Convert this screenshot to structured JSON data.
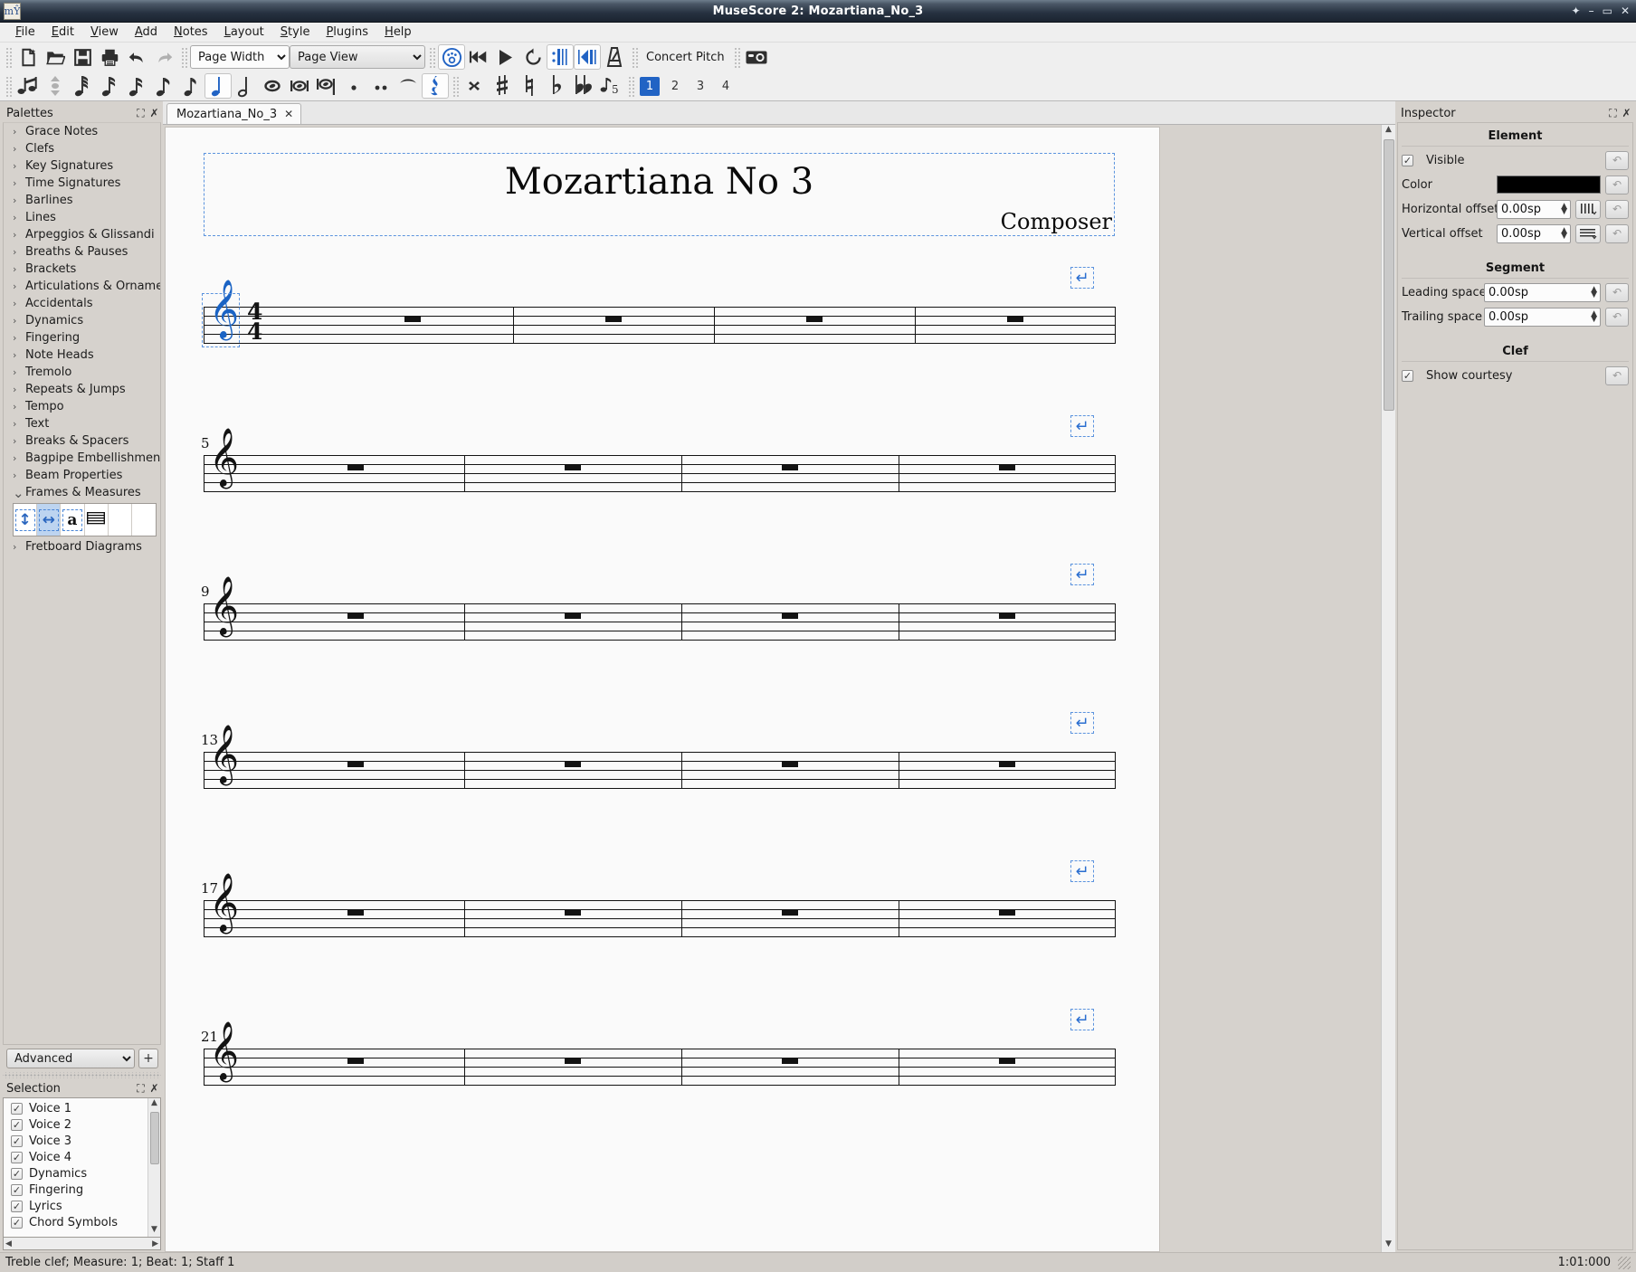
{
  "window": {
    "title": "MuseScore 2: Mozartiana_No_3",
    "app_icon": "musescore-logo-icon",
    "minimize": "–",
    "maximize": "▭",
    "close": "✕",
    "pin": "✦"
  },
  "menubar": [
    {
      "label": "File"
    },
    {
      "label": "Edit"
    },
    {
      "label": "View"
    },
    {
      "label": "Add"
    },
    {
      "label": "Notes"
    },
    {
      "label": "Layout"
    },
    {
      "label": "Style"
    },
    {
      "label": "Plugins"
    },
    {
      "label": "Help"
    }
  ],
  "toolbar": {
    "zoom_value": "Page Width",
    "view_value": "Page View",
    "concert_pitch_label": "Concert Pitch",
    "file_buttons": [
      "new-score-icon",
      "open-score-icon",
      "save-score-icon",
      "print-icon",
      "undo-icon",
      "redo-icon"
    ],
    "playback_buttons": [
      "midi-input-icon",
      "rewind-icon",
      "play-icon",
      "loop-icon",
      "play-repeats-icon",
      "play-next-icon",
      "metronome-icon"
    ],
    "camera_label": "image-capture-icon",
    "note_durations": [
      "64th-note",
      "32nd-note",
      "16th-note",
      "eighth-note",
      "quarter-note-selected",
      "half-note",
      "whole-note",
      "breve",
      "longa"
    ],
    "dot_buttons": [
      "augmentation-dot",
      "double-augmentation-dot"
    ],
    "tie_button": "tie-icon",
    "rest_button": "rest-icon",
    "accidentals": [
      "double-sharp",
      "sharp",
      "natural",
      "flat",
      "double-flat",
      "flip-direction"
    ],
    "voices": [
      "1",
      "2",
      "3",
      "4"
    ],
    "voice_selected": "1"
  },
  "palettes": {
    "title": "Palettes",
    "undock_icon": "undock-icon",
    "close_icon": "close-icon",
    "items": [
      {
        "label": "Grace Notes",
        "expanded": false
      },
      {
        "label": "Clefs",
        "expanded": false
      },
      {
        "label": "Key Signatures",
        "expanded": false
      },
      {
        "label": "Time Signatures",
        "expanded": false
      },
      {
        "label": "Barlines",
        "expanded": false
      },
      {
        "label": "Lines",
        "expanded": false
      },
      {
        "label": "Arpeggios & Glissandi",
        "expanded": false
      },
      {
        "label": "Breaths & Pauses",
        "expanded": false
      },
      {
        "label": "Brackets",
        "expanded": false
      },
      {
        "label": "Articulations & Ornaments",
        "expanded": false
      },
      {
        "label": "Accidentals",
        "expanded": false
      },
      {
        "label": "Dynamics",
        "expanded": false
      },
      {
        "label": "Fingering",
        "expanded": false
      },
      {
        "label": "Note Heads",
        "expanded": false
      },
      {
        "label": "Tremolo",
        "expanded": false
      },
      {
        "label": "Repeats & Jumps",
        "expanded": false
      },
      {
        "label": "Tempo",
        "expanded": false
      },
      {
        "label": "Text",
        "expanded": false
      },
      {
        "label": "Breaks & Spacers",
        "expanded": false
      },
      {
        "label": "Bagpipe Embellishments",
        "expanded": false
      },
      {
        "label": "Beam Properties",
        "expanded": false
      },
      {
        "label": "Frames & Measures",
        "expanded": true
      },
      {
        "label": "Fretboard Diagrams",
        "expanded": false
      }
    ],
    "frames_cells": [
      {
        "name": "vertical-frame",
        "glyph": "↕",
        "selected": false
      },
      {
        "name": "horizontal-frame",
        "glyph": "↔",
        "selected": true
      },
      {
        "name": "text-frame",
        "glyph": "a",
        "selected": false
      },
      {
        "name": "staff-measure",
        "glyph": "≡",
        "selected": false
      },
      {
        "name": "empty-cell-1",
        "glyph": "",
        "selected": false
      },
      {
        "name": "empty-cell-2",
        "glyph": "",
        "selected": false
      }
    ],
    "mode_value": "Advanced",
    "add_button": "+"
  },
  "selection": {
    "title": "Selection",
    "undock_icon": "undock-icon",
    "close_icon": "close-icon",
    "items": [
      {
        "label": "Voice 1",
        "checked": true
      },
      {
        "label": "Voice 2",
        "checked": true
      },
      {
        "label": "Voice 3",
        "checked": true
      },
      {
        "label": "Voice 4",
        "checked": true
      },
      {
        "label": "Dynamics",
        "checked": true
      },
      {
        "label": "Fingering",
        "checked": true
      },
      {
        "label": "Lyrics",
        "checked": true
      },
      {
        "label": "Chord Symbols",
        "checked": true
      }
    ]
  },
  "document_tab": {
    "label": "Mozartiana_No_3",
    "close_icon": "close-icon"
  },
  "score": {
    "title": "Mozartiana No 3",
    "composer": "Composer",
    "clef": "treble-clef",
    "clef_glyph": "𝄞",
    "time_signature": {
      "numerator": "4",
      "denominator": "4"
    },
    "systems": [
      {
        "measure_number": "",
        "first": true,
        "measures": 4
      },
      {
        "measure_number": "5",
        "first": false,
        "measures": 4
      },
      {
        "measure_number": "9",
        "first": false,
        "measures": 4
      },
      {
        "measure_number": "13",
        "first": false,
        "measures": 4
      },
      {
        "measure_number": "17",
        "first": false,
        "measures": 4
      },
      {
        "measure_number": "21",
        "first": false,
        "measures": 4
      }
    ],
    "break_marker_glyph": "↵"
  },
  "inspector": {
    "title": "Inspector",
    "undock_icon": "undock-icon",
    "close_icon": "close-icon",
    "element_section": "Element",
    "visible_label": "Visible",
    "visible_checked": true,
    "color_label": "Color",
    "color_value": "#000000",
    "horizontal_offset_label": "Horizontal offset",
    "horizontal_offset_value": "0.00sp",
    "vertical_offset_label": "Vertical offset",
    "vertical_offset_value": "0.00sp",
    "segment_section": "Segment",
    "leading_space_label": "Leading space",
    "leading_space_value": "0.00sp",
    "trailing_space_label": "Trailing space",
    "trailing_space_value": "0.00sp",
    "clef_section": "Clef",
    "show_courtesy_label": "Show courtesy",
    "show_courtesy_checked": true,
    "reset_icon": "reset-icon",
    "snap_h_icon": "snap-horizontal-icon",
    "snap_v_icon": "snap-vertical-icon"
  },
  "statusbar": {
    "text": "Treble clef;  Measure: 1; Beat: 1; Staff 1",
    "timecode": "1:01:000"
  },
  "colors": {
    "accent": "#2163c4",
    "selected_element": "#1a63c4",
    "frame_dash": "#5b93de",
    "panel_bg": "#d6d2cd",
    "toolbar_bg": "#efefef",
    "page_bg": "#fafafa"
  }
}
